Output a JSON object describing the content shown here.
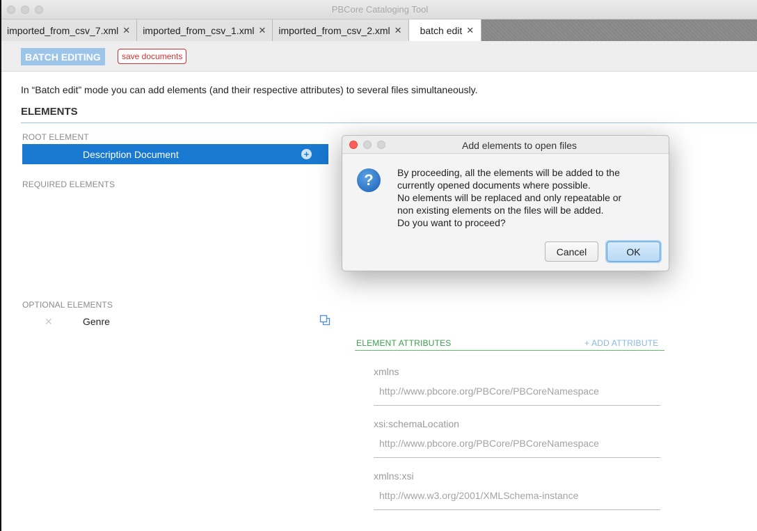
{
  "window": {
    "title": "PBCore Cataloging Tool"
  },
  "tabs": [
    {
      "label": "imported_from_csv_7.xml",
      "close": "✕"
    },
    {
      "label": "imported_from_csv_1.xml",
      "close": "✕"
    },
    {
      "label": "imported_from_csv_2.xml",
      "close": "✕"
    },
    {
      "label": "batch edit",
      "close": "✕",
      "active": true
    }
  ],
  "toolbar": {
    "batch_label": "BATCH EDITING",
    "save_label": "save documents"
  },
  "main": {
    "intro": "In “Batch edit” mode you can add elements (and their respective attributes) to several files simultaneously.",
    "elements_heading": "ELEMENTS",
    "root_label": "ROOT ELEMENT",
    "root_element": "Description Document",
    "root_add_icon": "plus-circle-icon",
    "required_label": "REQUIRED ELEMENTS",
    "optional_label": "OPTIONAL ELEMENTS",
    "optional_items": [
      {
        "remove": "✕",
        "name": "Genre",
        "icon": "copy-icon"
      }
    ]
  },
  "attributes": {
    "heading": "ELEMENT ATTRIBUTES",
    "add_label": "+ ADD ATTRIBUTE",
    "items": [
      {
        "key": "xmlns",
        "value": "http://www.pbcore.org/PBCore/PBCoreNamespace"
      },
      {
        "key": "xsi:schemaLocation",
        "value": "http://www.pbcore.org/PBCore/PBCoreNamespace"
      },
      {
        "key": "xmlns:xsi",
        "value": "http://www.w3.org/2001/XMLSchema-instance"
      }
    ]
  },
  "dialog": {
    "title": "Add elements to open files",
    "icon": "question-icon",
    "message_lines": [
      "By proceeding, all the elements will be added to the",
      "currently opened documents where possible.",
      "No elements will be replaced and only repeatable or",
      "non existing elements on the files will be added.",
      "Do you want to proceed?"
    ],
    "cancel_label": "Cancel",
    "ok_label": "OK"
  },
  "colors": {
    "accent_blue": "#1978d0",
    "batch_button": "#9dc5ea",
    "save_red": "#d32f2f",
    "attr_green": "#3aa04a",
    "close_light": "#fc5f57"
  }
}
